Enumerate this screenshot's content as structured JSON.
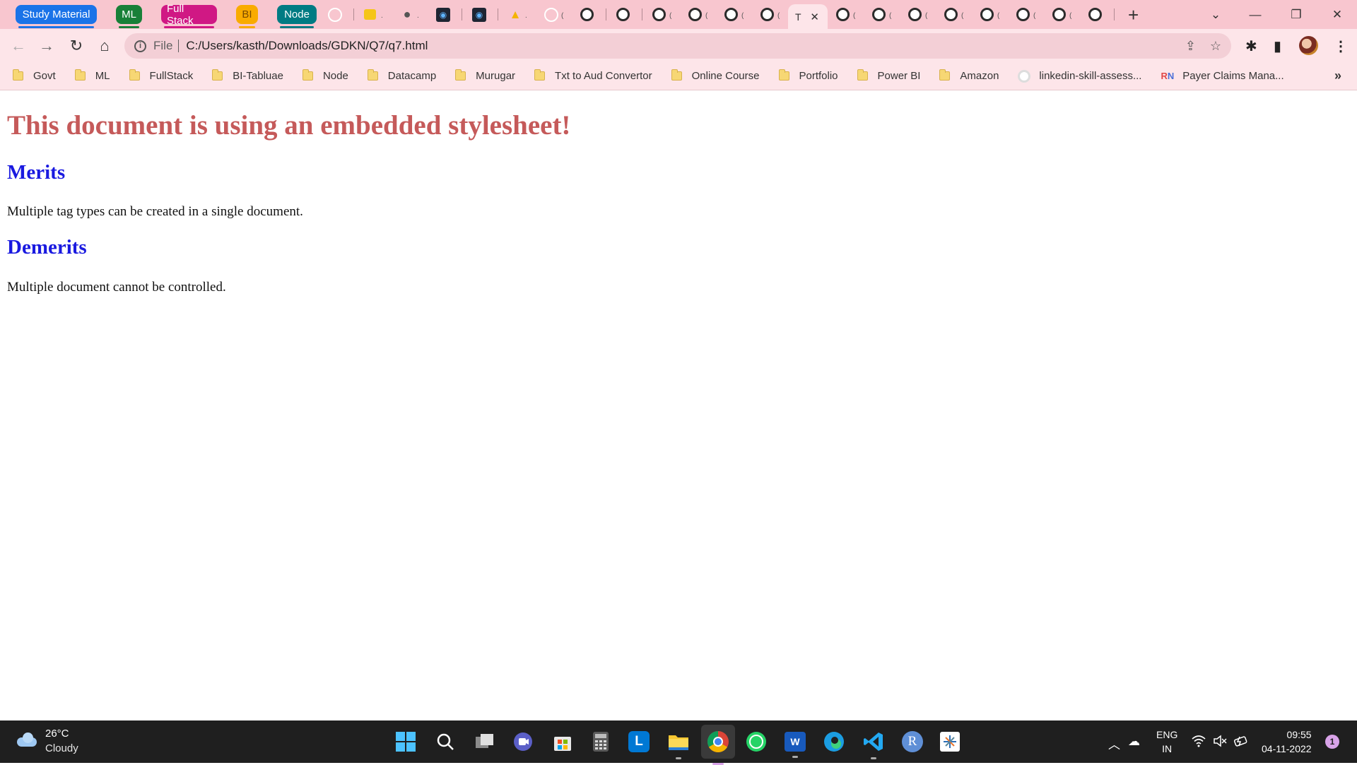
{
  "tab_groups": [
    {
      "label": "Study Material",
      "color": "#1a73e8"
    },
    {
      "label": "ML",
      "color": "#188038"
    },
    {
      "label": "Full Stack",
      "color": "#d01884"
    },
    {
      "label": "BI",
      "color": "#f9ab00"
    },
    {
      "label": "Node",
      "color": "#007b83"
    }
  ],
  "active_tab": {
    "label": "T",
    "close_glyph": "✕"
  },
  "new_tab_glyph": "+",
  "window_controls": {
    "dropdown": "⌄",
    "minimize": "—",
    "restore": "❐",
    "close": "✕"
  },
  "address_bar": {
    "scheme_label": "File",
    "url": "C:/Users/kasth/Downloads/GDKN/Q7/q7.html"
  },
  "bookmarks": [
    {
      "label": "Govt",
      "icon": "folder-icon"
    },
    {
      "label": "ML",
      "icon": "folder-icon"
    },
    {
      "label": "FullStack",
      "icon": "folder-icon"
    },
    {
      "label": "BI-Tabluae",
      "icon": "folder-icon"
    },
    {
      "label": "Node",
      "icon": "folder-icon"
    },
    {
      "label": "Datacamp",
      "icon": "folder-icon"
    },
    {
      "label": "Murugar",
      "icon": "folder-icon"
    },
    {
      "label": "Txt to Aud Convertor",
      "icon": "folder-icon"
    },
    {
      "label": "Online Course",
      "icon": "folder-icon"
    },
    {
      "label": "Portfolio",
      "icon": "folder-icon"
    },
    {
      "label": "Power BI",
      "icon": "folder-icon"
    },
    {
      "label": "Amazon",
      "icon": "folder-icon"
    },
    {
      "label": "linkedin-skill-assess...",
      "icon": "github-icon"
    },
    {
      "label": "Payer Claims Mana...",
      "icon": "rn-icon",
      "icon_text": "RN"
    }
  ],
  "bookmarks_more": "»",
  "page": {
    "heading": "This document is using an embedded stylesheet!",
    "merits_heading": "Merits",
    "merits_text": "Multiple tag types can be created in a single document.",
    "demerits_heading": "Demerits",
    "demerits_text": "Multiple document cannot be controlled.",
    "heading_color": "#c55a5a",
    "subheading_color": "#1a1ae0"
  },
  "taskbar": {
    "weather_temp": "26°C",
    "weather_condition": "Cloudy",
    "language_line1": "ENG",
    "language_line2": "IN",
    "time": "09:55",
    "date": "04-11-2022",
    "notification_count": "1",
    "r_app_label": "R",
    "l_app_label": "L",
    "w_app_label": "W"
  }
}
